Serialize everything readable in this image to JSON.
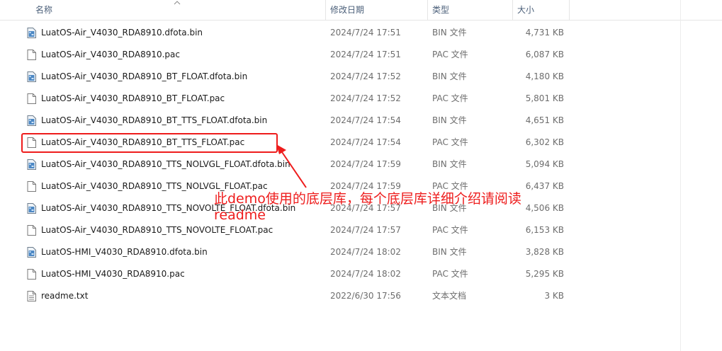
{
  "columns": {
    "name": "名称",
    "date": "修改日期",
    "type": "类型",
    "size": "大小"
  },
  "files": [
    {
      "name": "LuatOS-Air_V4030_RDA8910.dfota.bin",
      "date": "2024/7/24 17:51",
      "type": "BIN 文件",
      "size": "4,731 KB",
      "icon": "bin-file-icon"
    },
    {
      "name": "LuatOS-Air_V4030_RDA8910.pac",
      "date": "2024/7/24 17:51",
      "type": "PAC 文件",
      "size": "6,087 KB",
      "icon": "generic-file-icon"
    },
    {
      "name": "LuatOS-Air_V4030_RDA8910_BT_FLOAT.dfota.bin",
      "date": "2024/7/24 17:52",
      "type": "BIN 文件",
      "size": "4,180 KB",
      "icon": "bin-file-icon"
    },
    {
      "name": "LuatOS-Air_V4030_RDA8910_BT_FLOAT.pac",
      "date": "2024/7/24 17:52",
      "type": "PAC 文件",
      "size": "5,801 KB",
      "icon": "generic-file-icon"
    },
    {
      "name": "LuatOS-Air_V4030_RDA8910_BT_TTS_FLOAT.dfota.bin",
      "date": "2024/7/24 17:54",
      "type": "BIN 文件",
      "size": "4,651 KB",
      "icon": "bin-file-icon"
    },
    {
      "name": "LuatOS-Air_V4030_RDA8910_BT_TTS_FLOAT.pac",
      "date": "2024/7/24 17:54",
      "type": "PAC 文件",
      "size": "6,302 KB",
      "icon": "generic-file-icon"
    },
    {
      "name": "LuatOS-Air_V4030_RDA8910_TTS_NOLVGL_FLOAT.dfota.bin",
      "date": "2024/7/24 17:59",
      "type": "BIN 文件",
      "size": "5,094 KB",
      "icon": "bin-file-icon"
    },
    {
      "name": "LuatOS-Air_V4030_RDA8910_TTS_NOLVGL_FLOAT.pac",
      "date": "2024/7/24 17:59",
      "type": "PAC 文件",
      "size": "6,437 KB",
      "icon": "generic-file-icon"
    },
    {
      "name": "LuatOS-Air_V4030_RDA8910_TTS_NOVOLTE_FLOAT.dfota.bin",
      "date": "2024/7/24 17:57",
      "type": "BIN 文件",
      "size": "4,506 KB",
      "icon": "bin-file-icon"
    },
    {
      "name": "LuatOS-Air_V4030_RDA8910_TTS_NOVOLTE_FLOAT.pac",
      "date": "2024/7/24 17:57",
      "type": "PAC 文件",
      "size": "6,153 KB",
      "icon": "generic-file-icon"
    },
    {
      "name": "LuatOS-HMI_V4030_RDA8910.dfota.bin",
      "date": "2024/7/24 18:02",
      "type": "BIN 文件",
      "size": "3,828 KB",
      "icon": "bin-file-icon"
    },
    {
      "name": "LuatOS-HMI_V4030_RDA8910.pac",
      "date": "2024/7/24 18:02",
      "type": "PAC 文件",
      "size": "5,295 KB",
      "icon": "generic-file-icon"
    },
    {
      "name": "readme.txt",
      "date": "2022/6/30 17:56",
      "type": "文本文档",
      "size": "3 KB",
      "icon": "text-file-icon"
    }
  ],
  "annotation": {
    "text": "此demo使用的底层库，每个底层库详细介绍请阅读readme",
    "color": "#ee1c1c"
  }
}
